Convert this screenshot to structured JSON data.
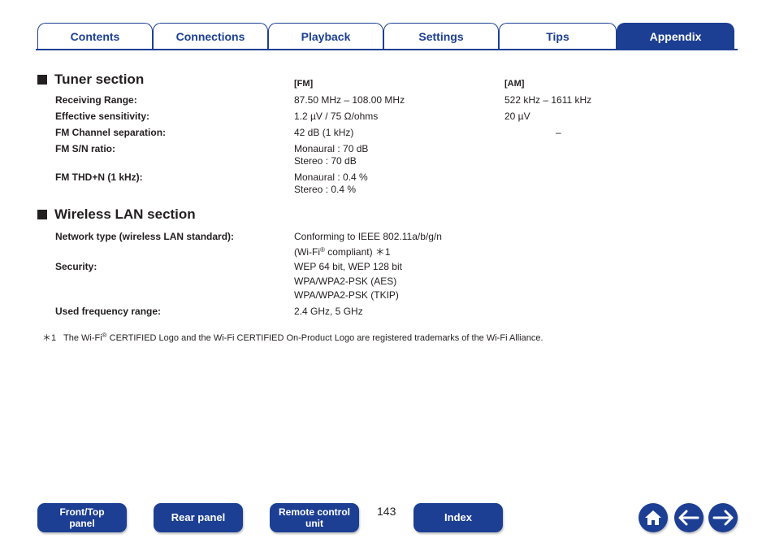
{
  "tabs": [
    {
      "label": "Contents",
      "active": false
    },
    {
      "label": "Connections",
      "active": false
    },
    {
      "label": "Playback",
      "active": false
    },
    {
      "label": "Settings",
      "active": false
    },
    {
      "label": "Tips",
      "active": false
    },
    {
      "label": "Appendix",
      "active": true
    }
  ],
  "tuner": {
    "title": "Tuner section",
    "fm_header": "[FM]",
    "am_header": "[AM]",
    "rows": [
      {
        "label": "Receiving Range:",
        "fm": [
          "87.50 MHz – 108.00 MHz"
        ],
        "am": "522 kHz – 1611 kHz"
      },
      {
        "label": "Effective sensitivity:",
        "fm": [
          "1.2 µV / 75 Ω/ohms"
        ],
        "am": "20 µV"
      },
      {
        "label": "FM Channel separation:",
        "fm": [
          "42 dB (1 kHz)"
        ],
        "am": "–"
      },
      {
        "label": "FM S/N ratio:",
        "fm": [
          "Monaural : 70 dB",
          "Stereo : 70 dB"
        ],
        "am": ""
      },
      {
        "label": "FM THD+N (1 kHz):",
        "fm": [
          "Monaural : 0.4 %",
          "Stereo : 0.4 %"
        ],
        "am": ""
      }
    ]
  },
  "wlan": {
    "title": "Wireless LAN section",
    "network_label": "Network type (wireless LAN standard):",
    "network_value_1": "Conforming to IEEE 802.11a/b/g/n",
    "network_value_2a": "(Wi-Fi",
    "network_value_2_sup": "®",
    "network_value_2b": " compliant) ＊1",
    "security_label": "Security:",
    "security_values": [
      "WEP 64 bit, WEP 128 bit",
      "WPA/WPA2-PSK (AES)",
      "WPA/WPA2-PSK (TKIP)"
    ],
    "freq_label": "Used frequency range:",
    "freq_value": "2.4 GHz, 5 GHz"
  },
  "footnote": {
    "marker": "＊1",
    "text_a": "The Wi-Fi",
    "sup": "®",
    "text_b": " CERTIFIED Logo and the Wi-Fi CERTIFIED On-Product Logo are registered trademarks of the Wi-Fi Alliance."
  },
  "bottom_nav": {
    "front_top_panel": [
      "Front/Top",
      "panel"
    ],
    "rear_panel": "Rear panel",
    "remote_control_unit": [
      "Remote control",
      "unit"
    ],
    "page_number": "143",
    "index": "Index"
  },
  "icons": {
    "home": "home-icon",
    "back": "arrow-left-icon",
    "forward": "arrow-right-icon"
  },
  "colors": {
    "accent": "#1c3f94",
    "text": "#231f20"
  }
}
